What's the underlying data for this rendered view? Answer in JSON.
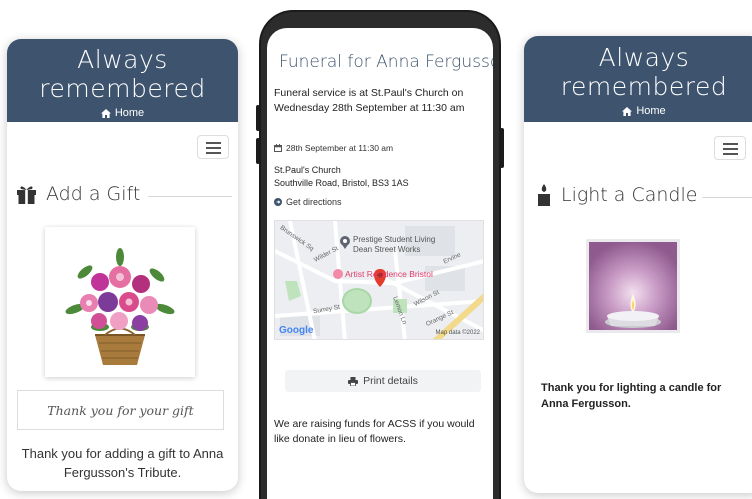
{
  "left_card": {
    "header_title_line1": "Always",
    "header_title_line2": "remembered",
    "home_label": "Home",
    "section_title": "Add a Gift",
    "gift_message": "Thank you for your gift",
    "thank_you_text": "Thank you for adding a gift to Anna Fergusson's Tribute."
  },
  "phone": {
    "title": "Funeral for Anna Fergusson",
    "service_text": "Funeral service is at St.Paul's Church on Wednesday 28th September at 11:30 am",
    "date_text": "28th September at 11:30 am",
    "venue_name": "St.Paul's Church",
    "venue_address": "Southville Road, Bristol, BS3 1AS",
    "directions_label": "Get directions",
    "map": {
      "place_1": "Prestige Student Living",
      "place_1b": "Dean Street Works",
      "place_2": "Artist Residence Bristol",
      "street_1": "Brunswick Sq",
      "street_2": "Wilder St",
      "street_3": "Surrey St",
      "street_4": "Wilson St",
      "street_5": "Orange St",
      "street_6": "Lemon Ln",
      "street_7": "Ervine",
      "google_label": "Google",
      "map_data_label": "Map data ©2022"
    },
    "print_label": "Print details",
    "donation_text": "We are raising funds for ACSS if you would like donate in lieu of flowers."
  },
  "right_card": {
    "header_title_line1": "Always",
    "header_title_line2": "remembered",
    "home_label": "Home",
    "section_title": "Light a Candle",
    "thank_you_text": "Thank you for lighting a candle for Anna Fergusson."
  },
  "colors": {
    "header_bg": "#3e546e",
    "accent_pink": "#e33c6a",
    "candle_purple": "#b585b2"
  }
}
